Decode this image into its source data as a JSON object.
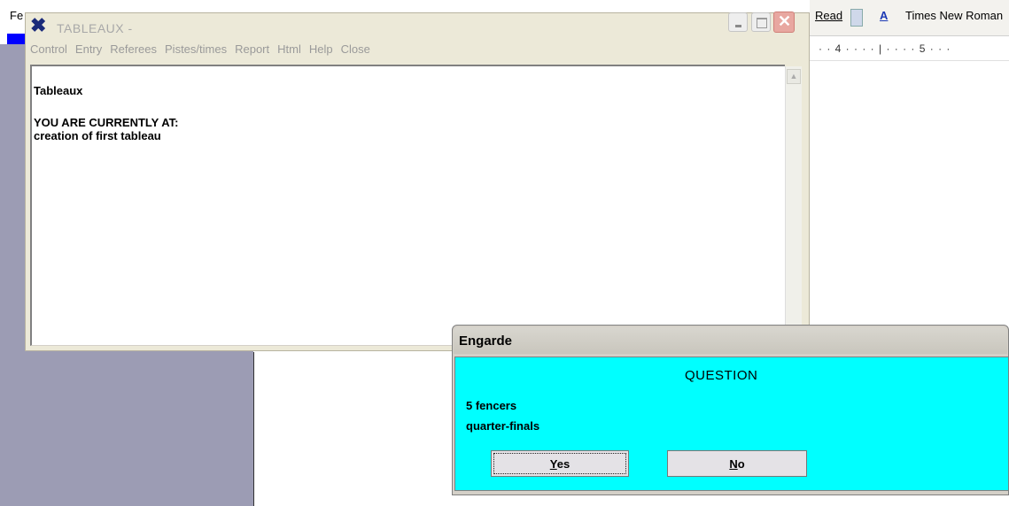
{
  "background": {
    "fe_label": "Fe",
    "word": {
      "read_label": "Read",
      "style_glyph": "A",
      "font_name": "Times New Roman",
      "ruler": "· · 4 · · · · | · · · · 5 · · ·"
    }
  },
  "tableaux_window": {
    "title": "TABLEAUX -",
    "icon": "crossed-swords-icon",
    "menu": [
      "Control",
      "Entry",
      "Referees",
      "Pistes/times",
      "Report",
      "Html",
      "Help",
      "Close"
    ],
    "content": {
      "heading": "Tableaux",
      "location_label": "YOU ARE CURRENTLY AT:",
      "location_value": "creation of first tableau"
    }
  },
  "dialog": {
    "title": "Engarde",
    "question": "QUESTION",
    "line1": "5 fencers",
    "line2": "quarter-finals",
    "yes_first": "Y",
    "yes_rest": "es",
    "no_first": "N",
    "no_rest": "o",
    "body_color": "#00ffff"
  }
}
